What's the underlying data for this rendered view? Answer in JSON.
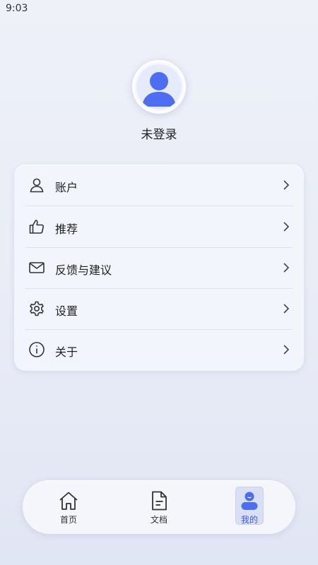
{
  "status_bar": {
    "time": "9:03"
  },
  "profile": {
    "login_status": "未登录",
    "avatar_icon": "user-avatar-icon"
  },
  "menu": {
    "items": [
      {
        "label": "账户",
        "icon": "user-icon"
      },
      {
        "label": "推荐",
        "icon": "thumbs-up-icon"
      },
      {
        "label": "反馈与建议",
        "icon": "mail-icon"
      },
      {
        "label": "设置",
        "icon": "gear-icon"
      },
      {
        "label": "关于",
        "icon": "info-icon"
      }
    ]
  },
  "bottom_nav": {
    "items": [
      {
        "label": "首页",
        "icon": "home-icon",
        "active": false
      },
      {
        "label": "文档",
        "icon": "document-icon",
        "active": false
      },
      {
        "label": "我的",
        "icon": "profile-icon",
        "active": true
      }
    ]
  },
  "colors": {
    "accent": "#3b5ee0",
    "avatar": "#4e6ef2"
  }
}
